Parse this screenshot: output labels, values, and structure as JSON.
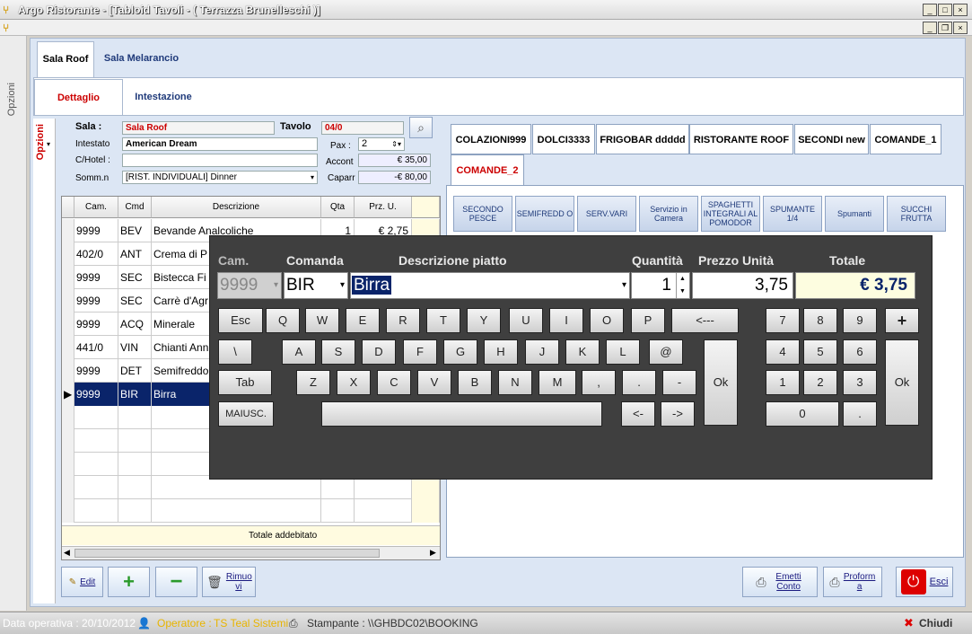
{
  "window": {
    "title": "Argo Ristorante - [Tabloid Tavoli - ( Terrazza Brunelleschi )]"
  },
  "side": {
    "opzioni": "Opzioni"
  },
  "rooms": {
    "tabs": [
      "Sala Roof",
      "Sala Melarancio"
    ]
  },
  "subtabs": [
    "Dettaglio",
    "Intestazione"
  ],
  "left_opzioni": "Opzioni",
  "form": {
    "sala_label": "Sala :",
    "sala_value": "Sala Roof",
    "tavolo_label": "Tavolo",
    "tavolo_value": "04/0",
    "intestato_label": "Intestato",
    "intestato_value": "American Dream",
    "pax_label": "Pax :",
    "pax_value": "2",
    "chotel_label": "C/Hotel :",
    "chotel_value": "",
    "accont_label": "Accont",
    "accont_value": "€ 35,00",
    "somm_label": "Somm.n",
    "somm_value": "[RIST. INDIVIDUALI]  Dinner",
    "capar_label": "Caparr",
    "capar_value": "-€ 80,00"
  },
  "grid": {
    "headers": [
      "Cam.",
      "Cmd",
      "Descrizione",
      "Qta",
      "Prz. U."
    ],
    "rows": [
      [
        "9999",
        "BEV",
        "Bevande Analcoliche",
        "1",
        "€ 2,75"
      ],
      [
        "402/0",
        "ANT",
        "Crema di P",
        "",
        ""
      ],
      [
        "9999",
        "SEC",
        "Bistecca Fi",
        "",
        ""
      ],
      [
        "9999",
        "SEC",
        "Carrè d'Agr",
        "",
        ""
      ],
      [
        "9999",
        "ACQ",
        "Minerale",
        "",
        ""
      ],
      [
        "441/0",
        "VIN",
        "Chianti Ann",
        "",
        ""
      ],
      [
        "9999",
        "DET",
        "Semifreddo",
        "",
        ""
      ],
      [
        "9999",
        "BIR",
        "Birra",
        "",
        ""
      ]
    ],
    "total_label": "Totale addebitato"
  },
  "categories": [
    "COLAZIONI999",
    "DOLCI3333",
    "FRIGOBAR ddddd",
    "RISTORANTE ROOF",
    "SECONDI new",
    "COMANDE_1",
    "COMANDE_2"
  ],
  "dishes": [
    "SECONDO PESCE",
    "SEMIFREDD O",
    "SERV.VARI",
    "Servizio in Camera",
    "SPAGHETTI INTEGRALI AL POMODOR",
    "SPUMANTE 1/4",
    "Spumanti",
    "SUCCHI FRUTTA"
  ],
  "popup": {
    "h_cam": "Cam.",
    "h_comanda": "Comanda",
    "h_desc": "Descrizione piatto",
    "h_qta": "Quantità",
    "h_prezzo": "Prezzo Unità",
    "h_totale": "Totale",
    "cam": "9999",
    "comanda": "BIR",
    "desc": "Birra",
    "qta": "1",
    "prezzo": "3,75",
    "totale": "€ 3,75",
    "row1": [
      "Esc",
      "Q",
      "W",
      "E",
      "R",
      "T",
      "Y",
      "U",
      "I",
      "O",
      "P",
      "<---"
    ],
    "row2": [
      "\\",
      "A",
      "S",
      "D",
      "F",
      "G",
      "H",
      "J",
      "K",
      "L",
      "@"
    ],
    "row3": [
      "Tab",
      "Z",
      "X",
      "C",
      "V",
      "B",
      "N",
      "M",
      ",",
      ".",
      "-"
    ],
    "row4": [
      "MAIUSC.",
      "",
      "<-",
      "->"
    ],
    "ok": "Ok",
    "num": [
      "7",
      "8",
      "9",
      "+",
      "4",
      "5",
      "6",
      "1",
      "2",
      "3",
      "0",
      "."
    ],
    "numok": "Ok"
  },
  "buttons": {
    "edit": "Edit",
    "rimuovi": "Rimuo vi",
    "emetti": "Emetti Conto",
    "proforma": "Proform a",
    "esci": "Esci"
  },
  "status": {
    "data": "Data operativa : 20/10/2012",
    "operatore_label": "Operatore :",
    "operatore": "TS Teal Sistemi",
    "stampante": "Stampante : \\\\GHBDC02\\BOOKING",
    "chiudi": "Chiudi"
  },
  "colors": {
    "accent": "#0a246a",
    "red": "#cc0000",
    "bar": "#3f3f3f"
  }
}
